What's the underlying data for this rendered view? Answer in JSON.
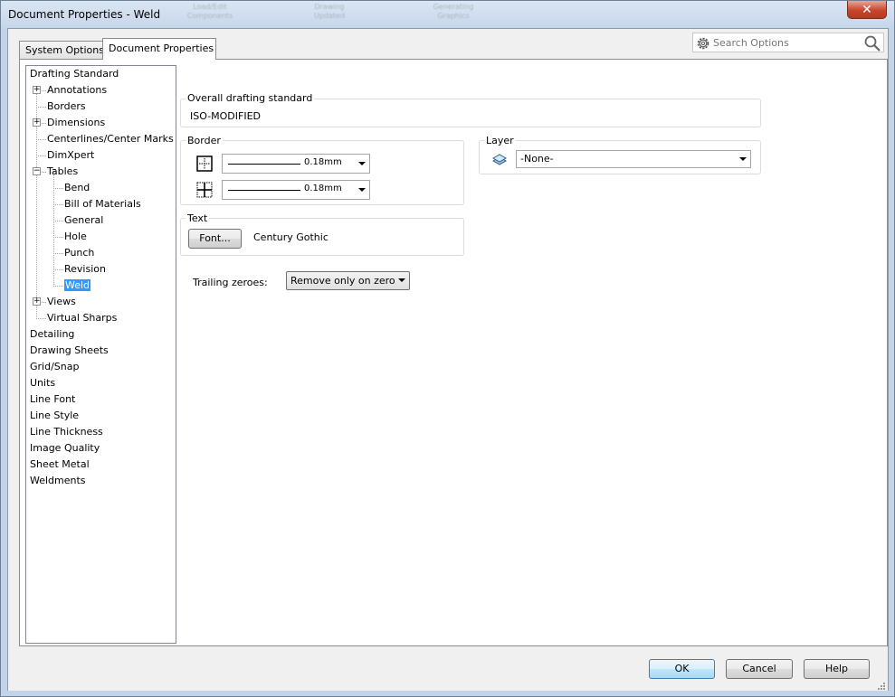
{
  "window": {
    "title": "Document Properties - Weld",
    "close_glyph": "✕",
    "bg_ribbon_ghost": [
      "Load/Edit\nComponents",
      "Drawing\nUpdated",
      "Generating\nGraphics"
    ]
  },
  "tabs": [
    {
      "label": "System Options",
      "active": false
    },
    {
      "label": "Document Properties",
      "active": true
    }
  ],
  "search": {
    "placeholder": "Search Options",
    "icon_left": "gear-icon",
    "icon_right": "search-icon"
  },
  "tree": [
    {
      "label": "Drafting Standard",
      "level": 0,
      "expander": "none",
      "selected": false
    },
    {
      "label": "Annotations",
      "level": 1,
      "expander": "+",
      "selected": false
    },
    {
      "label": "Borders",
      "level": 1,
      "expander": "none",
      "selected": false
    },
    {
      "label": "Dimensions",
      "level": 1,
      "expander": "+",
      "selected": false
    },
    {
      "label": "Centerlines/Center Marks",
      "level": 1,
      "expander": "none",
      "selected": false
    },
    {
      "label": "DimXpert",
      "level": 1,
      "expander": "none",
      "selected": false
    },
    {
      "label": "Tables",
      "level": 1,
      "expander": "-",
      "selected": false
    },
    {
      "label": "Bend",
      "level": 2,
      "expander": "none",
      "selected": false
    },
    {
      "label": "Bill of Materials",
      "level": 2,
      "expander": "none",
      "selected": false
    },
    {
      "label": "General",
      "level": 2,
      "expander": "none",
      "selected": false
    },
    {
      "label": "Hole",
      "level": 2,
      "expander": "none",
      "selected": false
    },
    {
      "label": "Punch",
      "level": 2,
      "expander": "none",
      "selected": false
    },
    {
      "label": "Revision",
      "level": 2,
      "expander": "none",
      "selected": false
    },
    {
      "label": "Weld",
      "level": 2,
      "expander": "none",
      "selected": true
    },
    {
      "label": "Views",
      "level": 1,
      "expander": "+",
      "selected": false
    },
    {
      "label": "Virtual Sharps",
      "level": 1,
      "expander": "none",
      "selected": false
    },
    {
      "label": "Detailing",
      "level": 0,
      "expander": "none",
      "selected": false
    },
    {
      "label": "Drawing Sheets",
      "level": 0,
      "expander": "none",
      "selected": false
    },
    {
      "label": "Grid/Snap",
      "level": 0,
      "expander": "none",
      "selected": false
    },
    {
      "label": "Units",
      "level": 0,
      "expander": "none",
      "selected": false
    },
    {
      "label": "Line Font",
      "level": 0,
      "expander": "none",
      "selected": false
    },
    {
      "label": "Line Style",
      "level": 0,
      "expander": "none",
      "selected": false
    },
    {
      "label": "Line Thickness",
      "level": 0,
      "expander": "none",
      "selected": false
    },
    {
      "label": "Image Quality",
      "level": 0,
      "expander": "none",
      "selected": false
    },
    {
      "label": "Sheet Metal",
      "level": 0,
      "expander": "none",
      "selected": false
    },
    {
      "label": "Weldments",
      "level": 0,
      "expander": "none",
      "selected": false
    }
  ],
  "overall_standard": {
    "label": "Overall drafting standard",
    "value": "ISO-MODIFIED"
  },
  "border": {
    "label": "Border",
    "outer": {
      "value": "0.18mm",
      "icon": "border-outer-icon"
    },
    "inner": {
      "value": "0.18mm",
      "icon": "border-inner-icon"
    }
  },
  "layer": {
    "label": "Layer",
    "value": "-None-",
    "icon": "layer-icon"
  },
  "text": {
    "label": "Text",
    "font_button": "Font...",
    "font_name": "Century Gothic"
  },
  "trailing_zeroes": {
    "label": "Trailing zeroes:",
    "value": "Remove only on zero"
  },
  "buttons": {
    "ok": "OK",
    "cancel": "Cancel",
    "help": "Help"
  }
}
